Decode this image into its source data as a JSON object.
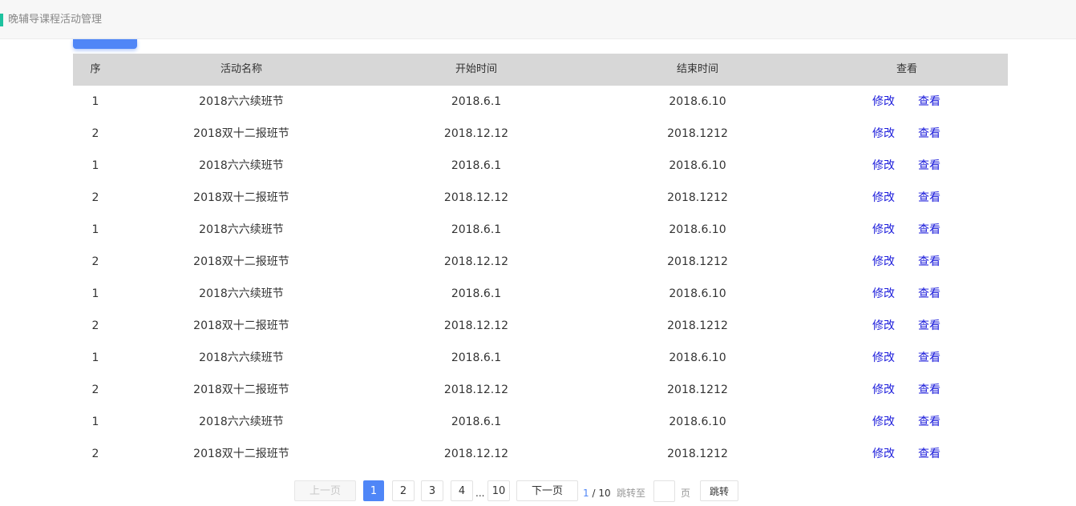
{
  "page": {
    "title": "晚辅导课程活动管理"
  },
  "colors": {
    "accent_bar": "#1ec29f",
    "primary": "#4f86f7",
    "link": "#1a1adb",
    "header_bg": "#d7d7d7"
  },
  "table": {
    "headers": {
      "seq": "序",
      "name": "活动名称",
      "start": "开始时间",
      "end": "结束时间",
      "view": "查看"
    },
    "rows": [
      {
        "seq": "1",
        "name": "2018六六续班节",
        "start": "2018.6.1",
        "end": "2018.6.10",
        "edit": "修改",
        "view": "查看"
      },
      {
        "seq": "2",
        "name": "2018双十二报班节",
        "start": "2018.12.12",
        "end": "2018.1212",
        "edit": "修改",
        "view": "查看"
      },
      {
        "seq": "1",
        "name": "2018六六续班节",
        "start": "2018.6.1",
        "end": "2018.6.10",
        "edit": "修改",
        "view": "查看"
      },
      {
        "seq": "2",
        "name": "2018双十二报班节",
        "start": "2018.12.12",
        "end": "2018.1212",
        "edit": "修改",
        "view": "查看"
      },
      {
        "seq": "1",
        "name": "2018六六续班节",
        "start": "2018.6.1",
        "end": "2018.6.10",
        "edit": "修改",
        "view": "查看"
      },
      {
        "seq": "2",
        "name": "2018双十二报班节",
        "start": "2018.12.12",
        "end": "2018.1212",
        "edit": "修改",
        "view": "查看"
      },
      {
        "seq": "1",
        "name": "2018六六续班节",
        "start": "2018.6.1",
        "end": "2018.6.10",
        "edit": "修改",
        "view": "查看"
      },
      {
        "seq": "2",
        "name": "2018双十二报班节",
        "start": "2018.12.12",
        "end": "2018.1212",
        "edit": "修改",
        "view": "查看"
      },
      {
        "seq": "1",
        "name": "2018六六续班节",
        "start": "2018.6.1",
        "end": "2018.6.10",
        "edit": "修改",
        "view": "查看"
      },
      {
        "seq": "2",
        "name": "2018双十二报班节",
        "start": "2018.12.12",
        "end": "2018.1212",
        "edit": "修改",
        "view": "查看"
      },
      {
        "seq": "1",
        "name": "2018六六续班节",
        "start": "2018.6.1",
        "end": "2018.6.10",
        "edit": "修改",
        "view": "查看"
      },
      {
        "seq": "2",
        "name": "2018双十二报班节",
        "start": "2018.12.12",
        "end": "2018.1212",
        "edit": "修改",
        "view": "查看"
      }
    ]
  },
  "pagination": {
    "prev": "上一页",
    "pages": [
      "1",
      "2",
      "3",
      "4"
    ],
    "ellipsis": "...",
    "last": "10",
    "next": "下一页",
    "current": "1",
    "total_label": "/ 10",
    "goto_label": "跳转至",
    "goto_value": "",
    "page_unit": "页",
    "jump": "跳转"
  }
}
